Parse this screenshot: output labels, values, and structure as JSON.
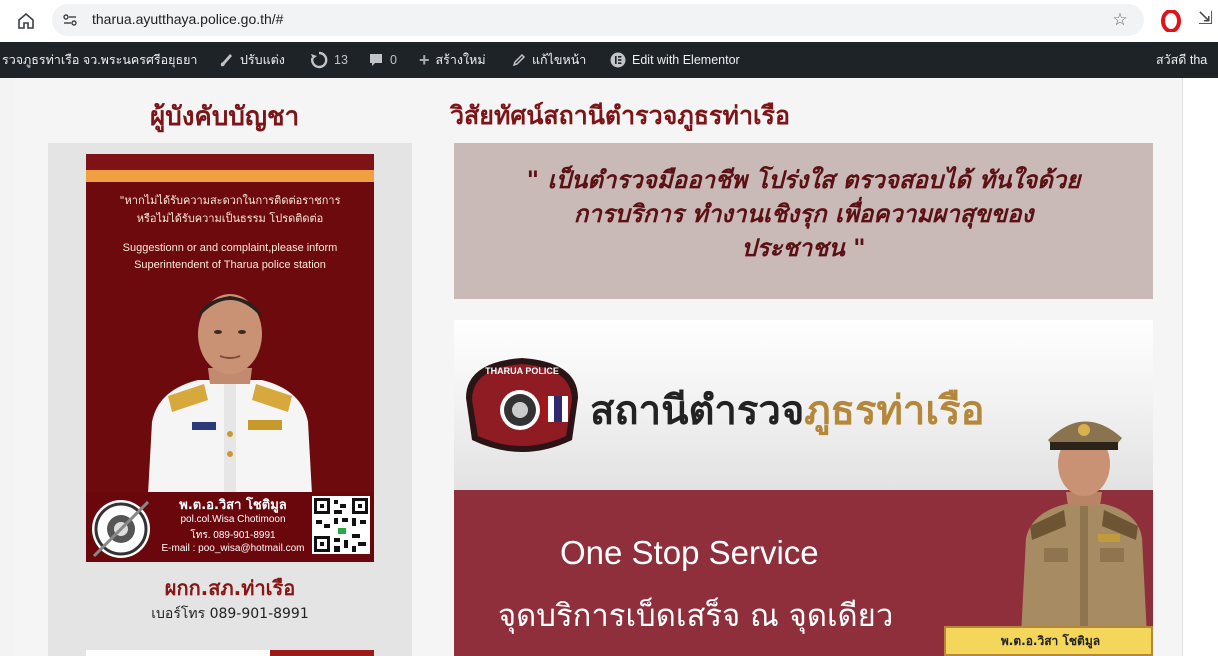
{
  "browser": {
    "url": "tharua.ayutthaya.police.go.th/#"
  },
  "admin_bar": {
    "site_name": "รวจภูธรท่าเรือ จว.พระนครศรีอยุธยา",
    "customize": "ปรับแต่ง",
    "updates": "13",
    "comments": "0",
    "new": "สร้างใหม่",
    "edit_page": "แก้ไขหน้า",
    "elementor": "Edit with Elementor",
    "greeting": "สวัสดี tha"
  },
  "left": {
    "heading": "ผู้บังคับบัญชา",
    "poster_thai": [
      "\"หากไม่ได้รับความสะดวกในการติดต่อราชการ",
      "หรือไม่ได้รับความเป็นธรรม โปรดติดต่อ"
    ],
    "poster_en": [
      "Suggestionn or and complaint,please inform",
      "Superintendent of Tharua police station"
    ],
    "officer_name_th": "พ.ต.อ.วิสา โชติมูล",
    "officer_name_en": "pol.col.Wisa Chotimoon",
    "officer_tel": "โทร. 089-901-8991",
    "officer_email": "E-mail : poo_wisa@hotmail.com",
    "caption": "ผกก.สภ.ท่าเรือ",
    "phone": "เบอร์โทร 089-901-8991"
  },
  "right": {
    "heading": "วิสัยทัศน์สถานีตำรวจภูธรท่าเรือ",
    "vision_lines": [
      "\" เป็นตำรวจมืออาชีพ โปร่งใส ตรวจสอบได้ ทันใจด้วย",
      "การบริการ ทำงานเชิงรุก เพื่อความผาสุขของ",
      "ประชาชน \""
    ],
    "banner": {
      "badge_text": "THARUA POLICE",
      "station_a": "สถานีตำรวจ",
      "station_b": "ภูธรท่าเรือ",
      "service_en": "One Stop Service",
      "service_th": "จุดบริการเบ็ดเสร็จ ณ จุดเดียว",
      "nameplate": "พ.ต.อ.วิสา โชติมูล"
    }
  },
  "colors": {
    "heading": "#7b1518",
    "poster_bg": "#6c0a0e",
    "quote_bg": "#c9bab8",
    "banner_red": "#8f2f3c",
    "wpbar": "#1d2327"
  }
}
